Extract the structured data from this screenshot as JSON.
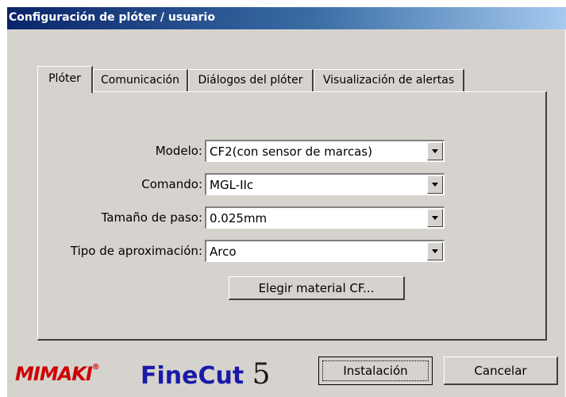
{
  "window": {
    "title": "Configuración de plóter / usuario"
  },
  "tabs": [
    {
      "label": "Plóter",
      "active": true
    },
    {
      "label": "Comunicación",
      "active": false
    },
    {
      "label": "Diálogos del plóter",
      "active": false
    },
    {
      "label": "Visualización de alertas",
      "active": false
    }
  ],
  "fields": {
    "modelo": {
      "label": "Modelo:",
      "value": "CF2(con sensor de marcas)"
    },
    "comando": {
      "label": "Comando:",
      "value": "MGL-IIc"
    },
    "tamano_paso": {
      "label": "Tamaño de paso:",
      "value": "0.025mm"
    },
    "tipo_aproximacion": {
      "label": "Tipo de aproximación:",
      "value": "Arco"
    }
  },
  "buttons": {
    "elegir_material": "Elegir material CF...",
    "instalacion": "Instalación",
    "cancelar": "Cancelar"
  },
  "logos": {
    "mimaki": "MIMAKI",
    "mimaki_mark": "®",
    "finecut_text": "FineCut",
    "finecut_version": "5",
    "mimaki_color": "#cc0000",
    "finecut_color": "#1a1aa8"
  }
}
